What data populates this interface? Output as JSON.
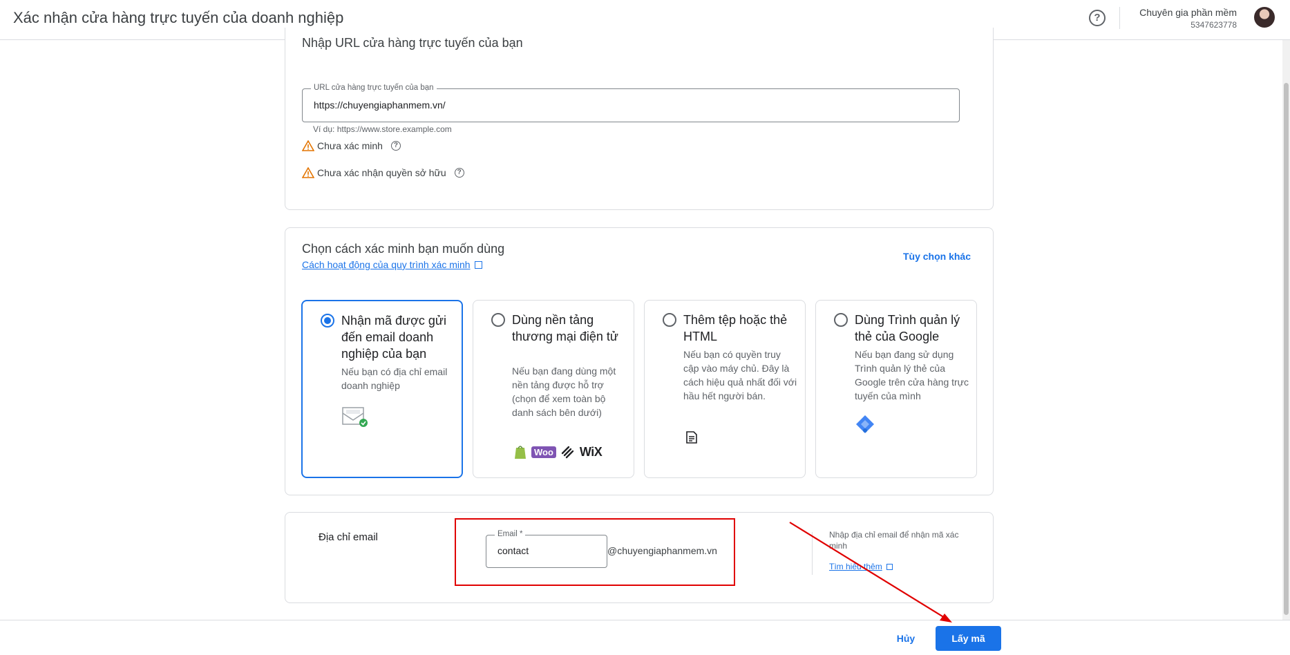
{
  "header": {
    "title": "Xác nhận cửa hàng trực tuyến của doanh nghiệp",
    "help_icon": "help-circle-icon",
    "account_name": "Chuyên gia phần mềm",
    "account_id": "5347623778"
  },
  "url_section": {
    "title": "Nhập URL cửa hàng trực tuyến của bạn",
    "field_label": "URL cửa hàng trực tuyến của bạn",
    "field_value": "https://chuyengiaphanmem.vn/",
    "hint": "Ví dụ: https://www.store.example.com",
    "status_items": [
      {
        "icon": "warning-icon",
        "label": "Chưa xác minh"
      },
      {
        "icon": "warning-icon",
        "label": "Chưa xác nhận quyền sở hữu"
      }
    ]
  },
  "method_section": {
    "title": "Chọn cách xác minh bạn muốn dùng",
    "how_link": "Cách hoạt động của quy trình xác minh",
    "more_options": "Tùy chọn khác",
    "options": [
      {
        "title": "Nhận mã được gửi đến email doanh nghiệp của bạn",
        "desc": "Nếu bạn có địa chỉ email doanh nghiệp",
        "selected": true
      },
      {
        "title": "Dùng nền tảng thương mại điện tử",
        "desc": "Nếu bạn đang dùng một nền tảng được hỗ trợ (chọn để xem toàn bộ danh sách bên dưới)",
        "selected": false,
        "logos": [
          "Woo",
          "WiX"
        ]
      },
      {
        "title": "Thêm tệp hoặc thẻ HTML",
        "desc": "Nếu bạn có quyền truy cập vào máy chủ. Đây là cách hiệu quả nhất đối với hầu hết người bán.",
        "selected": false
      },
      {
        "title": "Dùng Trình quản lý thẻ của Google",
        "desc": "Nếu bạn đang sử dụng Trình quản lý thẻ của Google trên cửa hàng trực tuyến của mình",
        "selected": false
      }
    ]
  },
  "email_section": {
    "label": "Địa chỉ email",
    "field_label": "Email *",
    "field_value": "contact",
    "domain": "@chuyengiaphanmem.vn",
    "side_text": "Nhập địa chỉ email để nhận mã xác minh",
    "side_link": "Tìm hiểu thêm"
  },
  "footer": {
    "cancel": "Hủy",
    "get_code": "Lấy mã"
  },
  "colors": {
    "accent": "#1a73e8",
    "highlight": "#e00000",
    "warning": "#e37400"
  }
}
